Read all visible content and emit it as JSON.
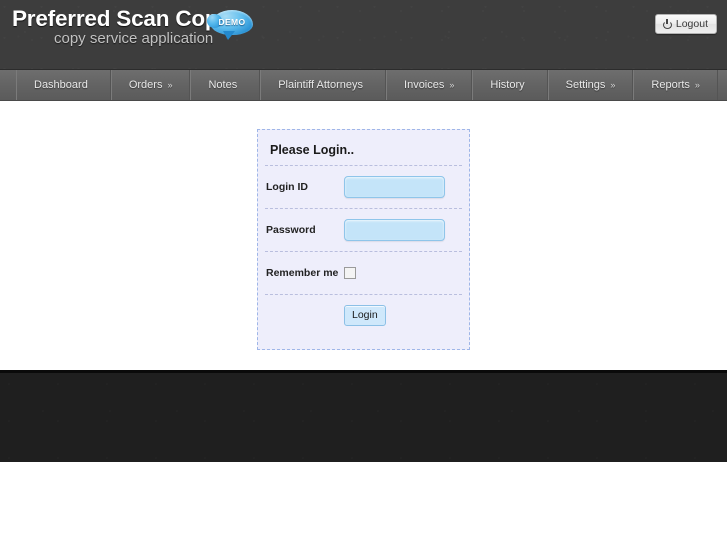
{
  "header": {
    "logo_title": "Preferred Scan Copy",
    "logo_subtitle": "copy service application",
    "demo_badge": "DEMO",
    "logout_label": "Logout",
    "logout_icon": "power-icon",
    "bg_color": "#3d3d3d"
  },
  "nav": {
    "bg_color": "#636363",
    "items": [
      {
        "label": "Dashboard",
        "caret": ""
      },
      {
        "label": "Orders",
        "caret": "»"
      },
      {
        "label": "Notes",
        "caret": ""
      },
      {
        "label": "Plaintiff Attorneys",
        "caret": ""
      },
      {
        "label": "Invoices",
        "caret": "»"
      },
      {
        "label": "History",
        "caret": ""
      },
      {
        "label": "Settings",
        "caret": "»"
      },
      {
        "label": "Reports",
        "caret": "»"
      }
    ]
  },
  "login": {
    "title": "Please Login..",
    "panel_bg": "#eeeefb",
    "input_bg": "#c4e4f9",
    "login_id_label": "Login ID",
    "login_id_value": "",
    "login_id_placeholder": "",
    "password_label": "Password",
    "password_value": "",
    "password_placeholder": "",
    "remember_label": "Remember me",
    "remember_checked": false,
    "submit_label": "Login"
  },
  "footer": {
    "bg_color": "#1f1f1f"
  }
}
